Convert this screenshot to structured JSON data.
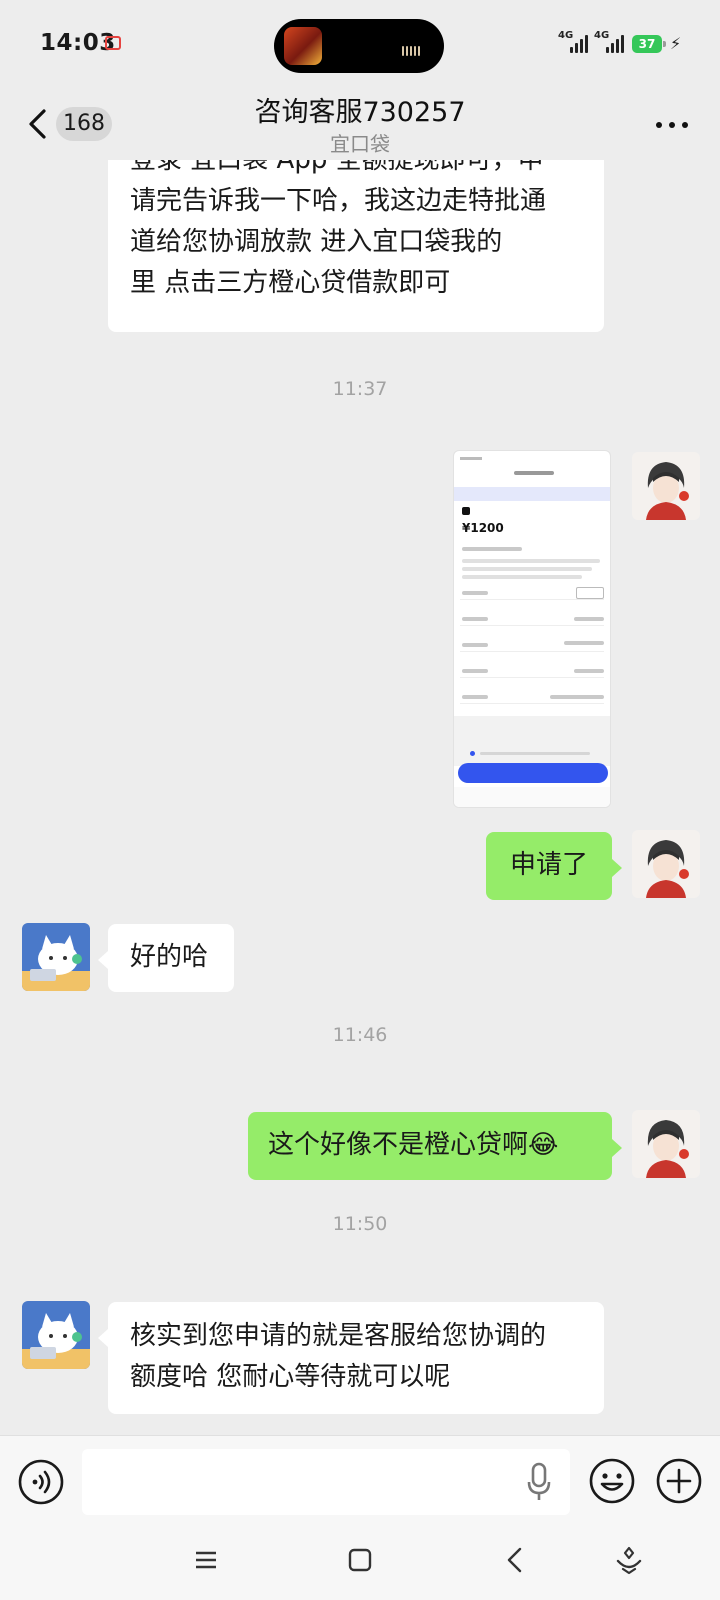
{
  "status_bar": {
    "time": "14:03",
    "network_1": "4G",
    "network_2": "4G",
    "battery": "37"
  },
  "nav": {
    "unread_count": "168",
    "title": "咨询客服730257",
    "subtitle": "宜口袋"
  },
  "messages": [
    {
      "type": "text",
      "side": "in",
      "lines": [
        "登录 宜口袋 App 全额提现即可，申",
        "请完告诉我一下哈，我这边走特批通",
        "道给您协调放款    进入宜口袋我的",
        "里 点击三方橙心贷借款即可"
      ]
    },
    {
      "type": "time",
      "text": "11:37"
    },
    {
      "type": "image",
      "side": "out",
      "amount": "¥1200"
    },
    {
      "type": "text",
      "side": "out",
      "text": "申请了"
    },
    {
      "type": "text",
      "side": "in",
      "text": "好的哈"
    },
    {
      "type": "time",
      "text": "11:46"
    },
    {
      "type": "text",
      "side": "out",
      "text": "这个好像不是橙心贷啊",
      "emoji": "😂"
    },
    {
      "type": "time",
      "text": "11:50"
    },
    {
      "type": "text",
      "side": "in",
      "lines": [
        "核实到您申请的就是客服给您协调的",
        "额度哈  您耐心等待就可以呢"
      ]
    }
  ],
  "colors": {
    "background": "#ededed",
    "incoming_bubble": "#ffffff",
    "outgoing_bubble": "#95ec69",
    "battery": "#35c759"
  },
  "icons": [
    "back-icon",
    "more-icon",
    "voice-icon",
    "microphone-icon",
    "emoji-icon",
    "plus-icon",
    "menu-icon",
    "home-icon",
    "back-nav-icon",
    "assistant-icon"
  ]
}
